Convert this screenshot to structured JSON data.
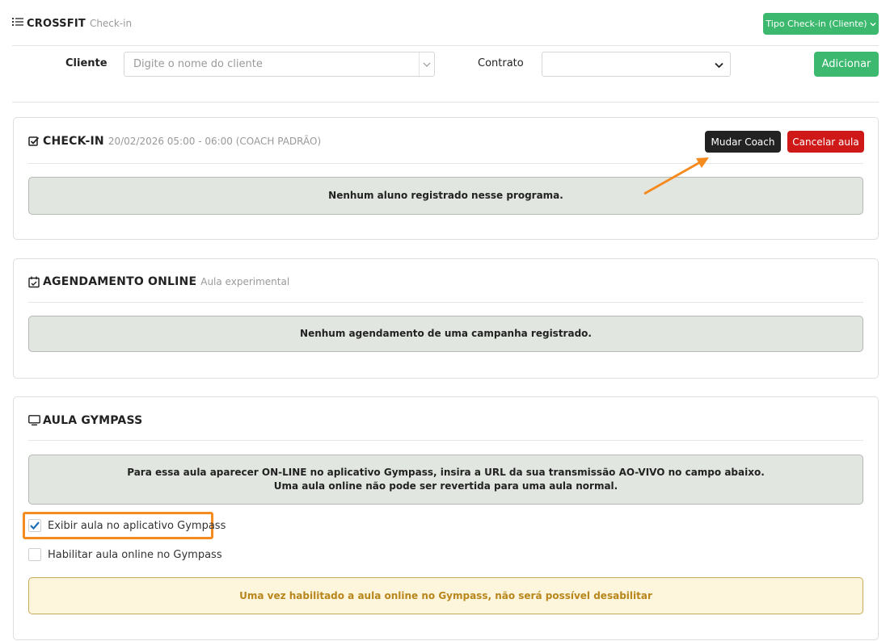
{
  "header": {
    "brand": "CROSSFIT",
    "subtitle": "Check-in",
    "tipo_button": "Tipo Check-in (Cliente)",
    "tipo_icon": "chevron-down-icon",
    "list_icon": "list-icon"
  },
  "form": {
    "cliente_label": "Cliente",
    "cliente_placeholder": "Digite o nome do cliente",
    "contrato_label": "Contrato",
    "contrato_value": "",
    "add_button": "Adicionar"
  },
  "checkin": {
    "icon": "checkbox-icon",
    "title": "CHECK-IN",
    "subtitle": "20/02/2026 05:00 - 06:00 (COACH PADRÃO)",
    "change_coach_button": "Mudar Coach",
    "cancel_button": "Cancelar aula",
    "empty_message": "Nenhum aluno registrado nesse programa."
  },
  "agendamento": {
    "icon": "calendar-check-icon",
    "title": "AGENDAMENTO ONLINE",
    "subtitle": "Aula experimental",
    "empty_message": "Nenhum agendamento de uma campanha registrado."
  },
  "gympass": {
    "icon": "monitor-icon",
    "title": "AULA GYMPASS",
    "info_line1": "Para essa aula aparecer ON-LINE no aplicativo Gympass, insira a URL da sua transmissão AO-VIVO no campo abaixo.",
    "info_line2": "Uma aula online não pode ser revertida para uma aula normal.",
    "show_in_app_label": "Exibir aula no aplicativo Gympass",
    "show_in_app_checked": true,
    "enable_online_label": "Habilitar aula online no Gympass",
    "enable_online_checked": false,
    "warning": "Uma vez habilitado a aula online no Gympass, não será possível desabilitar"
  },
  "colors": {
    "green": "#3cb96e",
    "dark": "#222222",
    "red": "#cf1919",
    "orange_highlight": "#f58a1f",
    "alert_gray": "#e2e6e1",
    "warning_bg": "#fdf5dc",
    "warning_text": "#b8861b"
  }
}
